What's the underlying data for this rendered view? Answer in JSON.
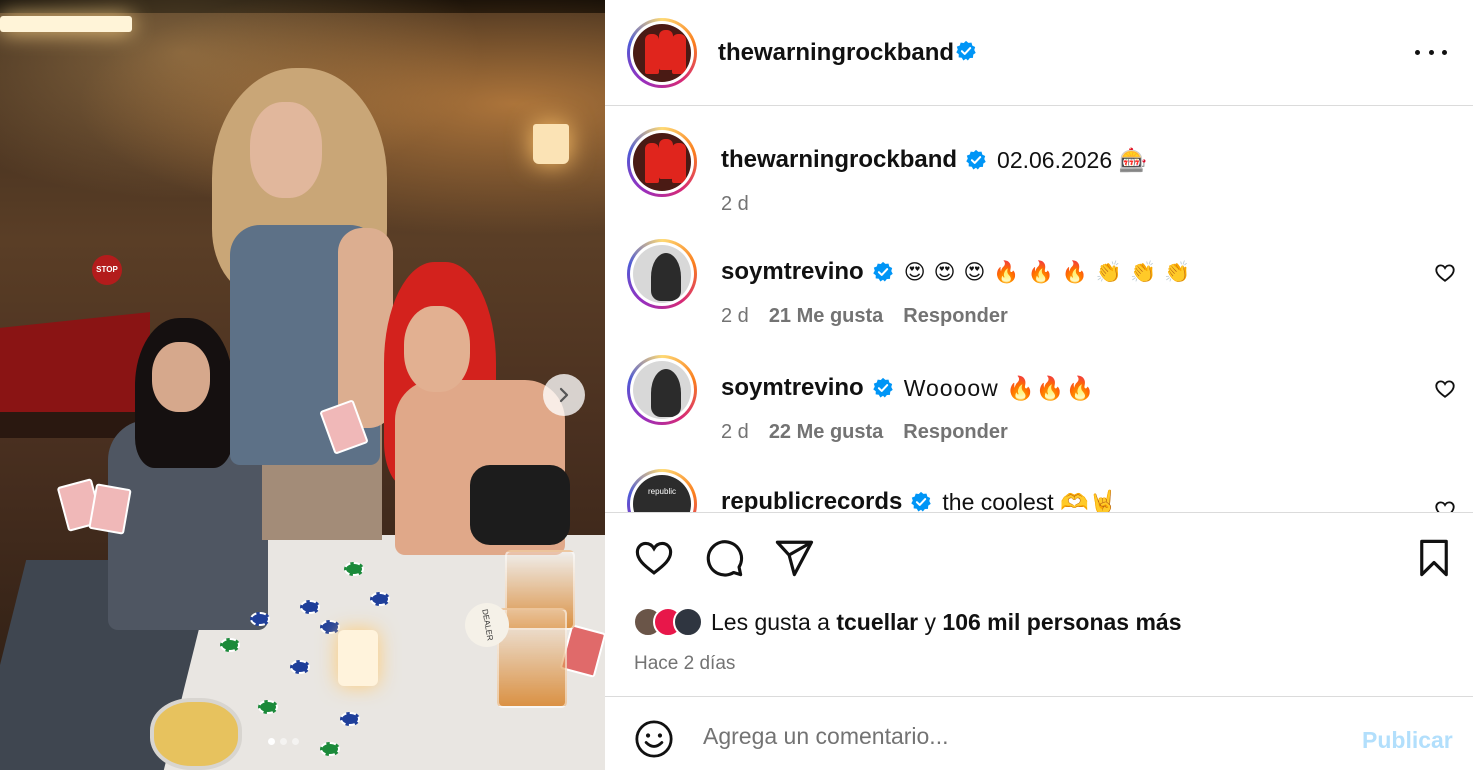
{
  "post": {
    "author": "thewarningrockband",
    "more_icon": "more-horizontal-icon",
    "image": {
      "stop_sign": "STOP",
      "dealer_button": "DEALER",
      "carousel_dots": 3,
      "active_dot": 1
    }
  },
  "caption": {
    "username": "thewarningrockband",
    "text": "02.06.2026 🎰",
    "time": "2 d"
  },
  "comments": [
    {
      "username": "soymtrevino",
      "text": "😍😍😍🔥🔥🔥👏👏👏",
      "time": "2 d",
      "likes": "21 Me gusta",
      "reply": "Responder"
    },
    {
      "username": "soymtrevino",
      "text": "Woooow 🔥🔥🔥",
      "time": "2 d",
      "likes": "22 Me gusta",
      "reply": "Responder"
    },
    {
      "username": "republicrecords",
      "avatar_text": "republic",
      "text": "the coolest 🫶🤘",
      "time": "",
      "likes": "",
      "reply": ""
    }
  ],
  "likes": {
    "prefix": "Les gusta a",
    "user": "tcuellar",
    "joiner": "y",
    "others": "106 mil personas más"
  },
  "date": "Hace 2 días",
  "composer": {
    "placeholder": "Agrega un comentario...",
    "publish": "Publicar"
  },
  "colors": {
    "verified": "#0095f6",
    "publish_disabled": "#b2dffc",
    "secondary_text": "#737373"
  }
}
